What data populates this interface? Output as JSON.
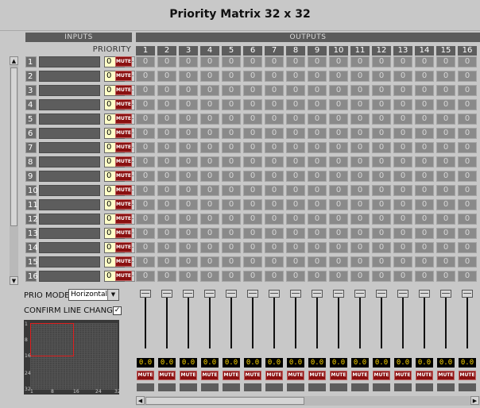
{
  "window": {
    "title": "Priority Matrix 32 x 32"
  },
  "headers": {
    "inputs": "INPUTS",
    "outputs": "OUTPUTS",
    "priority": "PRIORITY"
  },
  "columns": [
    "1",
    "2",
    "3",
    "4",
    "5",
    "6",
    "7",
    "8",
    "9",
    "10",
    "11",
    "12",
    "13",
    "14",
    "15",
    "16"
  ],
  "rows": [
    {
      "num": "1",
      "priority": "0",
      "mute": "MUTE",
      "cells": [
        "0",
        "0",
        "0",
        "0",
        "0",
        "0",
        "0",
        "0",
        "0",
        "0",
        "0",
        "0",
        "0",
        "0",
        "0",
        "0"
      ]
    },
    {
      "num": "2",
      "priority": "0",
      "mute": "MUTE",
      "cells": [
        "0",
        "0",
        "0",
        "0",
        "0",
        "0",
        "0",
        "0",
        "0",
        "0",
        "0",
        "0",
        "0",
        "0",
        "0",
        "0"
      ]
    },
    {
      "num": "3",
      "priority": "0",
      "mute": "MUTE",
      "cells": [
        "0",
        "0",
        "0",
        "0",
        "0",
        "0",
        "0",
        "0",
        "0",
        "0",
        "0",
        "0",
        "0",
        "0",
        "0",
        "0"
      ]
    },
    {
      "num": "4",
      "priority": "0",
      "mute": "MUTE",
      "cells": [
        "0",
        "0",
        "0",
        "0",
        "0",
        "0",
        "0",
        "0",
        "0",
        "0",
        "0",
        "0",
        "0",
        "0",
        "0",
        "0"
      ]
    },
    {
      "num": "5",
      "priority": "0",
      "mute": "MUTE",
      "cells": [
        "0",
        "0",
        "0",
        "0",
        "0",
        "0",
        "0",
        "0",
        "0",
        "0",
        "0",
        "0",
        "0",
        "0",
        "0",
        "0"
      ]
    },
    {
      "num": "6",
      "priority": "0",
      "mute": "MUTE",
      "cells": [
        "0",
        "0",
        "0",
        "0",
        "0",
        "0",
        "0",
        "0",
        "0",
        "0",
        "0",
        "0",
        "0",
        "0",
        "0",
        "0"
      ]
    },
    {
      "num": "7",
      "priority": "0",
      "mute": "MUTE",
      "cells": [
        "0",
        "0",
        "0",
        "0",
        "0",
        "0",
        "0",
        "0",
        "0",
        "0",
        "0",
        "0",
        "0",
        "0",
        "0",
        "0"
      ]
    },
    {
      "num": "8",
      "priority": "0",
      "mute": "MUTE",
      "cells": [
        "0",
        "0",
        "0",
        "0",
        "0",
        "0",
        "0",
        "0",
        "0",
        "0",
        "0",
        "0",
        "0",
        "0",
        "0",
        "0"
      ]
    },
    {
      "num": "9",
      "priority": "0",
      "mute": "MUTE",
      "cells": [
        "0",
        "0",
        "0",
        "0",
        "0",
        "0",
        "0",
        "0",
        "0",
        "0",
        "0",
        "0",
        "0",
        "0",
        "0",
        "0"
      ]
    },
    {
      "num": "10",
      "priority": "0",
      "mute": "MUTE",
      "cells": [
        "0",
        "0",
        "0",
        "0",
        "0",
        "0",
        "0",
        "0",
        "0",
        "0",
        "0",
        "0",
        "0",
        "0",
        "0",
        "0"
      ]
    },
    {
      "num": "11",
      "priority": "0",
      "mute": "MUTE",
      "cells": [
        "0",
        "0",
        "0",
        "0",
        "0",
        "0",
        "0",
        "0",
        "0",
        "0",
        "0",
        "0",
        "0",
        "0",
        "0",
        "0"
      ]
    },
    {
      "num": "12",
      "priority": "0",
      "mute": "MUTE",
      "cells": [
        "0",
        "0",
        "0",
        "0",
        "0",
        "0",
        "0",
        "0",
        "0",
        "0",
        "0",
        "0",
        "0",
        "0",
        "0",
        "0"
      ]
    },
    {
      "num": "13",
      "priority": "0",
      "mute": "MUTE",
      "cells": [
        "0",
        "0",
        "0",
        "0",
        "0",
        "0",
        "0",
        "0",
        "0",
        "0",
        "0",
        "0",
        "0",
        "0",
        "0",
        "0"
      ]
    },
    {
      "num": "14",
      "priority": "0",
      "mute": "MUTE",
      "cells": [
        "0",
        "0",
        "0",
        "0",
        "0",
        "0",
        "0",
        "0",
        "0",
        "0",
        "0",
        "0",
        "0",
        "0",
        "0",
        "0"
      ]
    },
    {
      "num": "15",
      "priority": "0",
      "mute": "MUTE",
      "cells": [
        "0",
        "0",
        "0",
        "0",
        "0",
        "0",
        "0",
        "0",
        "0",
        "0",
        "0",
        "0",
        "0",
        "0",
        "0",
        "0"
      ]
    },
    {
      "num": "16",
      "priority": "0",
      "mute": "MUTE",
      "cells": [
        "0",
        "0",
        "0",
        "0",
        "0",
        "0",
        "0",
        "0",
        "0",
        "0",
        "0",
        "0",
        "0",
        "0",
        "0",
        "0"
      ]
    }
  ],
  "controls": {
    "prio_mode_label": "PRIO MODE",
    "prio_mode_value": "Horizontal",
    "confirm_label": "CONFIRM LINE CHANGE",
    "confirm_checked": "✓"
  },
  "overview": {
    "y_labels": [
      "1",
      "8",
      "16",
      "24",
      "32"
    ],
    "x_labels": [
      "1",
      "8",
      "16",
      "24",
      "32"
    ]
  },
  "faders": [
    {
      "value": "0.0",
      "mute": "MUTE"
    },
    {
      "value": "0.0",
      "mute": "MUTE"
    },
    {
      "value": "0.0",
      "mute": "MUTE"
    },
    {
      "value": "0.0",
      "mute": "MUTE"
    },
    {
      "value": "0.0",
      "mute": "MUTE"
    },
    {
      "value": "0.0",
      "mute": "MUTE"
    },
    {
      "value": "0.0",
      "mute": "MUTE"
    },
    {
      "value": "0.0",
      "mute": "MUTE"
    },
    {
      "value": "0.0",
      "mute": "MUTE"
    },
    {
      "value": "0.0",
      "mute": "MUTE"
    },
    {
      "value": "0.0",
      "mute": "MUTE"
    },
    {
      "value": "0.0",
      "mute": "MUTE"
    },
    {
      "value": "0.0",
      "mute": "MUTE"
    },
    {
      "value": "0.0",
      "mute": "MUTE"
    },
    {
      "value": "0.0",
      "mute": "MUTE"
    },
    {
      "value": "0.0",
      "mute": "MUTE"
    }
  ],
  "icons": {
    "scroll_up": "▲",
    "scroll_down": "▼",
    "scroll_left": "◀",
    "scroll_right": "▶",
    "dropdown": "▼"
  }
}
